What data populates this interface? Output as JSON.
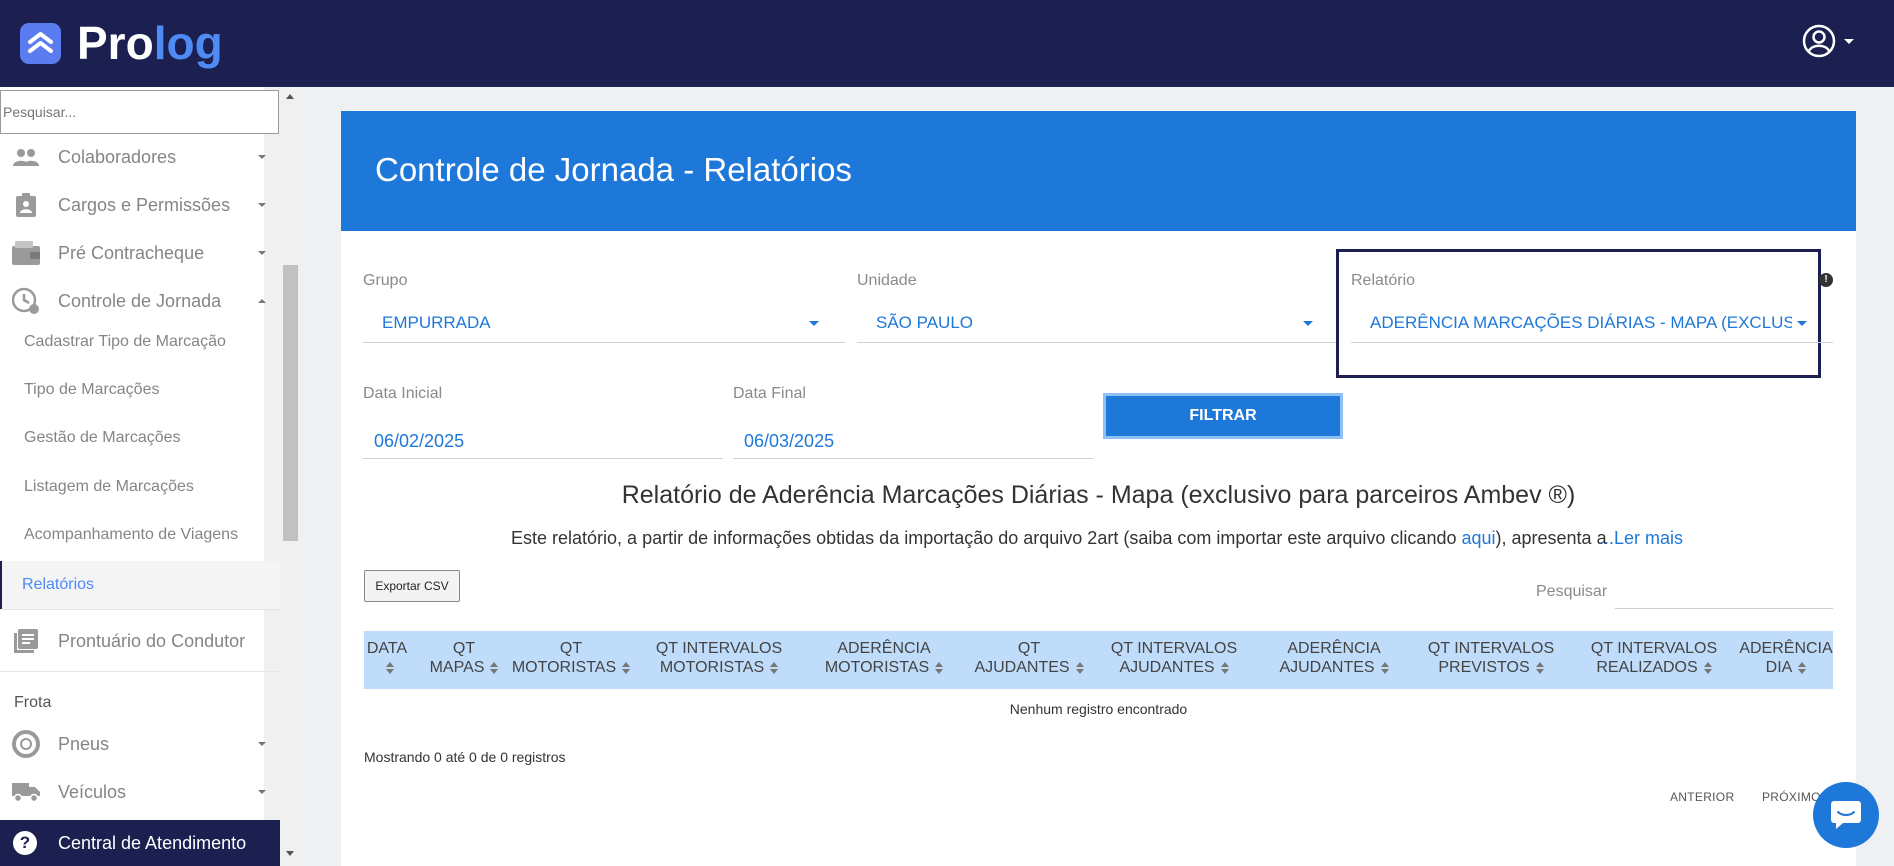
{
  "brand": {
    "name_part1": "Pro",
    "name_part2": "log"
  },
  "colors": {
    "topbar": "#1c2050",
    "accent": "#1e78d9",
    "header_blue": "#1e78d9",
    "table_head": "#bfdcfa"
  },
  "sidebar": {
    "search_placeholder": "Pesquisar...",
    "items": [
      {
        "label": "Colaboradores",
        "icon": "people-icon"
      },
      {
        "label": "Cargos e Permissões",
        "icon": "badge-icon"
      },
      {
        "label": "Pré Contracheque",
        "icon": "wallet-icon"
      },
      {
        "label": "Controle de Jornada",
        "icon": "clock-icon"
      }
    ],
    "subitems": [
      {
        "label": "Cadastrar Tipo de Marcação"
      },
      {
        "label": "Tipo de Marcações"
      },
      {
        "label": "Gestão de Marcações"
      },
      {
        "label": "Listagem de Marcações"
      },
      {
        "label": "Acompanhamento de Viagens"
      },
      {
        "label": "Relatórios",
        "active": true
      }
    ],
    "prontuario": "Prontuário do Condutor",
    "section_frota": "Frota",
    "pneus": "Pneus",
    "veiculos": "Veículos",
    "central": "Central de Atendimento"
  },
  "page": {
    "title": "Controle de Jornada - Relatórios",
    "grupo": {
      "label": "Grupo",
      "value": "EMPURRADA"
    },
    "unidade": {
      "label": "Unidade",
      "value": "SÃO PAULO"
    },
    "relatorio": {
      "label": "Relatório",
      "value": "ADERÊNCIA MARCAÇÕES DIÁRIAS - MAPA (EXCLUSIVO PARA PARCEIROS AMBEV ®)"
    },
    "data_inicial": {
      "label": "Data Inicial",
      "value": "06/02/2025"
    },
    "data_final": {
      "label": "Data Final",
      "value": "06/03/2025"
    },
    "filtrar": "FILTRAR",
    "report_title": "Relatório de Aderência Marcações Diárias - Mapa (exclusivo para parceiros Ambev ®)",
    "report_desc_pre": "Este relatório, a partir de informações obtidas da importação do arquivo 2art (saiba com importar este arquivo clicando ",
    "report_desc_link": "aqui",
    "report_desc_post": "), apresenta a",
    "ler_mais": "...Ler mais",
    "export_csv": "Exportar CSV",
    "search_label": "Pesquisar",
    "columns": [
      {
        "l1": "DATA",
        "l2": ""
      },
      {
        "l1": "QT",
        "l2": "MAPAS"
      },
      {
        "l1": "QT",
        "l2": "MOTORISTAS"
      },
      {
        "l1": "QT INTERVALOS",
        "l2": "MOTORISTAS"
      },
      {
        "l1": "ADERÊNCIA",
        "l2": "MOTORISTAS"
      },
      {
        "l1": "QT",
        "l2": "AJUDANTES"
      },
      {
        "l1": "QT INTERVALOS",
        "l2": "AJUDANTES"
      },
      {
        "l1": "ADERÊNCIA",
        "l2": "AJUDANTES"
      },
      {
        "l1": "QT INTERVALOS",
        "l2": "PREVISTOS"
      },
      {
        "l1": "QT INTERVALOS",
        "l2": "REALIZADOS"
      },
      {
        "l1": "ADERÊNCIA",
        "l2": "DIA"
      }
    ],
    "empty": "Nenhum registro encontrado",
    "showing": "Mostrando 0 até 0 de 0 registros",
    "anterior": "ANTERIOR",
    "proximo": "PRÓXIMO"
  }
}
